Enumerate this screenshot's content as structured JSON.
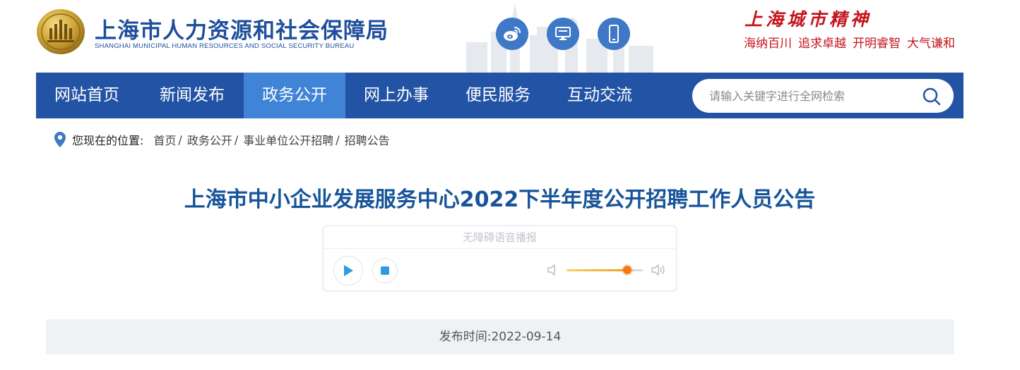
{
  "header": {
    "title_cn": "上海市人力资源和社会保障局",
    "title_en": "SHANGHAI MUNICIPAL HUMAN RESOURCES AND SOCIAL SECURITY BUREAU",
    "social_icons": [
      "weibo-icon",
      "desktop-icon",
      "mobile-icon"
    ],
    "spirit": {
      "title": "上海城市精神",
      "words": [
        "海纳百川",
        "追求卓越",
        "开明睿智",
        "大气谦和"
      ]
    }
  },
  "nav": {
    "items": [
      {
        "label": "网站首页",
        "active": false
      },
      {
        "label": "新闻发布",
        "active": false
      },
      {
        "label": "政务公开",
        "active": true
      },
      {
        "label": "网上办事",
        "active": false
      },
      {
        "label": "便民服务",
        "active": false
      },
      {
        "label": "互动交流",
        "active": false
      }
    ],
    "search": {
      "placeholder": "请输入关键字进行全网检索",
      "value": ""
    }
  },
  "breadcrumb": {
    "label": "您现在的位置:",
    "items": [
      "首页",
      "政务公开",
      "事业单位公开招聘",
      "招聘公告"
    ]
  },
  "article": {
    "title": "上海市中小企业发展服务中心2022下半年度公开招聘工作人员公告",
    "publish_label": "发布时间:",
    "publish_date": "2022-09-14"
  },
  "player": {
    "title": "无障碍语音播报",
    "volume": 0.8
  },
  "colors": {
    "brand_blue": "#2353a4",
    "nav_active": "#3f84d6",
    "title_blue": "#17549a",
    "spirit_red": "#c4141b",
    "volume_orange": "#f57c14"
  }
}
